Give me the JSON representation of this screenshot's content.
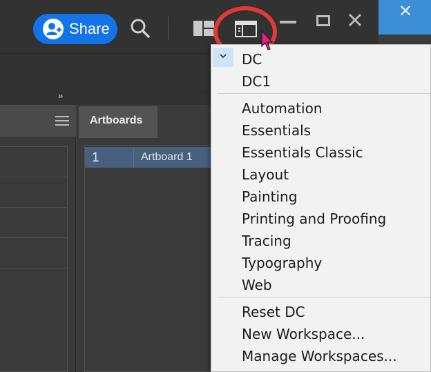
{
  "topbar": {
    "share_label": "Share"
  },
  "os": {
    "close_glyph": "✕"
  },
  "panels": {
    "collapse_glyph": "»",
    "artboards_tab": "Artboards",
    "artboard_rows": [
      {
        "number": "1",
        "name": "Artboard 1"
      }
    ]
  },
  "workspace_menu": {
    "active_item": "DC",
    "items_group1": [
      "DC",
      "DC1"
    ],
    "items_group2": [
      "Automation",
      "Essentials",
      "Essentials Classic",
      "Layout",
      "Painting",
      "Printing and Proofing",
      "Tracing",
      "Typography",
      "Web"
    ],
    "items_group3": [
      "Reset DC",
      "New Workspace...",
      "Manage Workspaces..."
    ]
  },
  "colors": {
    "accent": "#1473e6",
    "highlight_ring": "#e53935",
    "cursor": "#e91e8c",
    "selection_row": "#46607e"
  },
  "icons": [
    "user-icon",
    "search-icon",
    "arrange-documents-icon",
    "workspace-switcher-icon",
    "minimize-icon",
    "maximize-icon",
    "close-icon",
    "hamburger-icon",
    "check-icon",
    "mouse-cursor-icon"
  ]
}
